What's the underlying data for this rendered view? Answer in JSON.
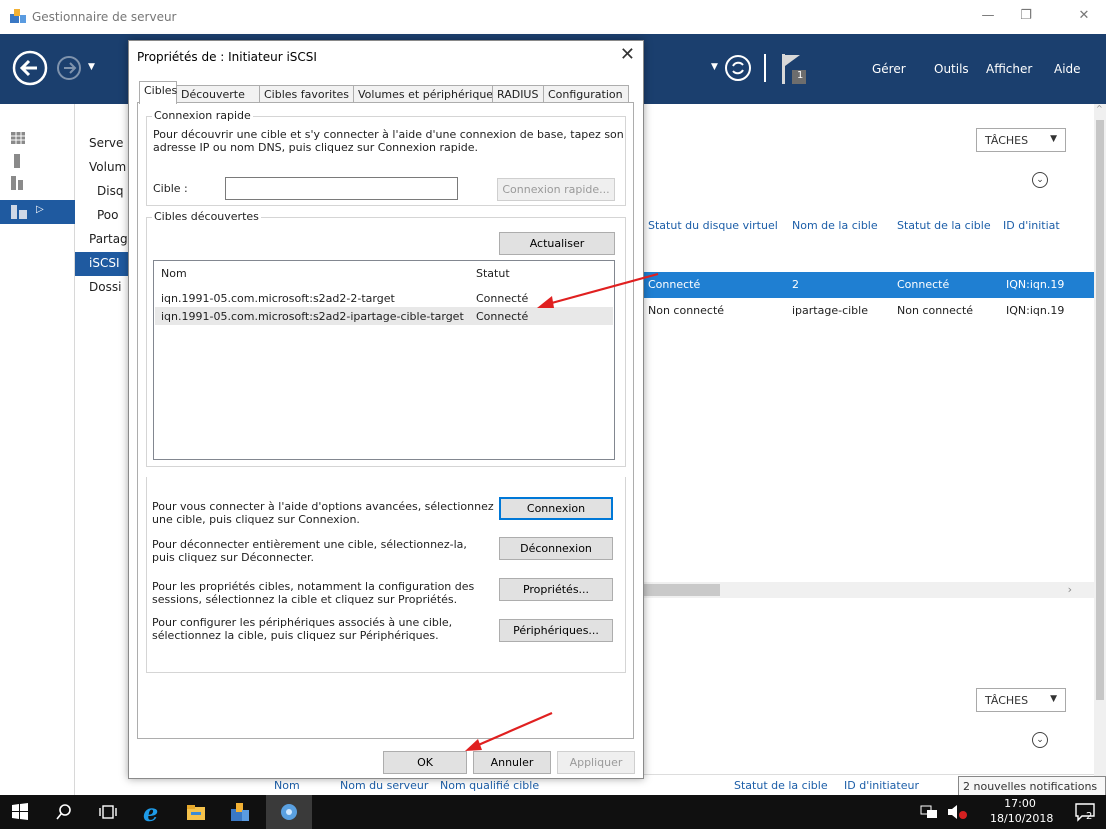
{
  "window": {
    "title": "Gestionnaire de serveur"
  },
  "toolbar": {
    "gerer": "Gérer",
    "outils": "Outils",
    "afficher": "Afficher",
    "aide": "Aide",
    "flag_count": "1"
  },
  "nav": {
    "items": [
      "Serve",
      "Volum",
      "Disq",
      "Poo",
      "Partag",
      "iSCSI",
      "Dossi"
    ]
  },
  "content": {
    "tasks_label": "TÂCHES",
    "columns": [
      "Statut du disque virtuel",
      "Nom de la cible",
      "Statut de la cible",
      "ID d'initiat"
    ],
    "rows": [
      {
        "c1": "Connecté",
        "c2": "2",
        "c3": "Connecté",
        "c4": "IQN:iqn.19"
      },
      {
        "c1": "Non connecté",
        "c2": "ipartage-cible",
        "c3": "Non connecté",
        "c4": "IQN:iqn.19"
      }
    ],
    "bottom_columns": [
      "Nom",
      "Nom du serveur",
      "Nom qualifié cible",
      "Statut de la cible",
      "ID d'initiateur"
    ],
    "notification": "2 nouvelles notifications"
  },
  "dialog": {
    "title": "Propriétés de : Initiateur iSCSI",
    "tabs": [
      "Cibles",
      "Découverte",
      "Cibles favorites",
      "Volumes et périphériques",
      "RADIUS",
      "Configuration"
    ],
    "quick": {
      "legend": "Connexion rapide",
      "desc_1": "Pour découvrir une cible et s'y connecter à l'aide d'une connexion de base, tapez son",
      "desc_2": "adresse IP ou nom DNS, puis cliquez sur Connexion rapide.",
      "target_label": "Cible :",
      "target_value": "",
      "quick_btn": "Connexion rapide..."
    },
    "discovered": {
      "legend": "Cibles découvertes",
      "refresh_btn": "Actualiser",
      "col_name": "Nom",
      "col_status": "Statut",
      "rows": [
        {
          "name": "iqn.1991-05.com.microsoft:s2ad2-2-target",
          "status": "Connecté"
        },
        {
          "name": "iqn.1991-05.com.microsoft:s2ad2-ipartage-cible-target",
          "status": "Connecté"
        }
      ]
    },
    "actions": [
      {
        "l1": "Pour vous connecter à l'aide d'options avancées, sélectionnez",
        "l2": "une cible, puis cliquez sur Connexion.",
        "btn": "Connexion"
      },
      {
        "l1": "Pour déconnecter entièrement une cible, sélectionnez-la,",
        "l2": "puis cliquez sur Déconnecter.",
        "btn": "Déconnexion"
      },
      {
        "l1": "Pour les propriétés cibles, notamment la configuration des",
        "l2": "sessions, sélectionnez la cible et cliquez sur Propriétés.",
        "btn": "Propriétés..."
      },
      {
        "l1": "Pour configurer les périphériques associés à une cible,",
        "l2": "sélectionnez la cible, puis cliquez sur Périphériques.",
        "btn": "Périphériques..."
      }
    ],
    "ok": "OK",
    "cancel": "Annuler",
    "apply": "Appliquer"
  },
  "taskbar": {
    "time": "17:00",
    "date": "18/10/2018",
    "notif_count": "2"
  },
  "colors": {
    "toolbar": "#1b3f6e",
    "selection": "#1f7fd2",
    "nav_active": "#1f5aa0",
    "arrow": "#e02020"
  }
}
